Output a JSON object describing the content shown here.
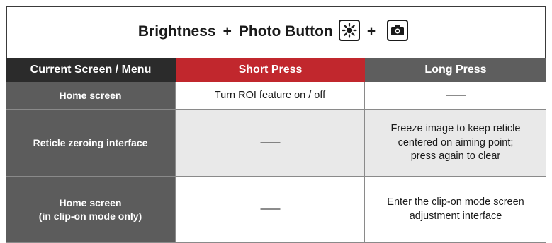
{
  "title": {
    "part1": "Brightness",
    "plus1": "+",
    "part2": "Photo Button",
    "plus2": "+",
    "icon1": "brightness-sun-icon",
    "icon2": "camera-icon"
  },
  "headers": {
    "col1": "Current Screen / Menu",
    "col2": "Short Press",
    "col3": "Long Press"
  },
  "colors": {
    "header_dark": "#2b2b2b",
    "header_red": "#c1272d",
    "header_gray": "#5e5e5e",
    "label_bg": "#5c5c5c",
    "alt_row_bg": "#e9e9e9"
  },
  "rows": [
    {
      "label": "Home screen",
      "label_line2": "",
      "short": "Turn ROI feature on / off",
      "long": "——"
    },
    {
      "label": "Reticle zeroing interface",
      "label_line2": "",
      "short": "——",
      "long_line1": "Freeze image to keep reticle",
      "long_line2": "centered on aiming point;",
      "long_line3": "press again to clear"
    },
    {
      "label": "Home screen",
      "label_line2": "(in clip-on mode only)",
      "short": "——",
      "long_line1": "Enter the clip-on mode screen",
      "long_line2": "adjustment interface"
    }
  ]
}
